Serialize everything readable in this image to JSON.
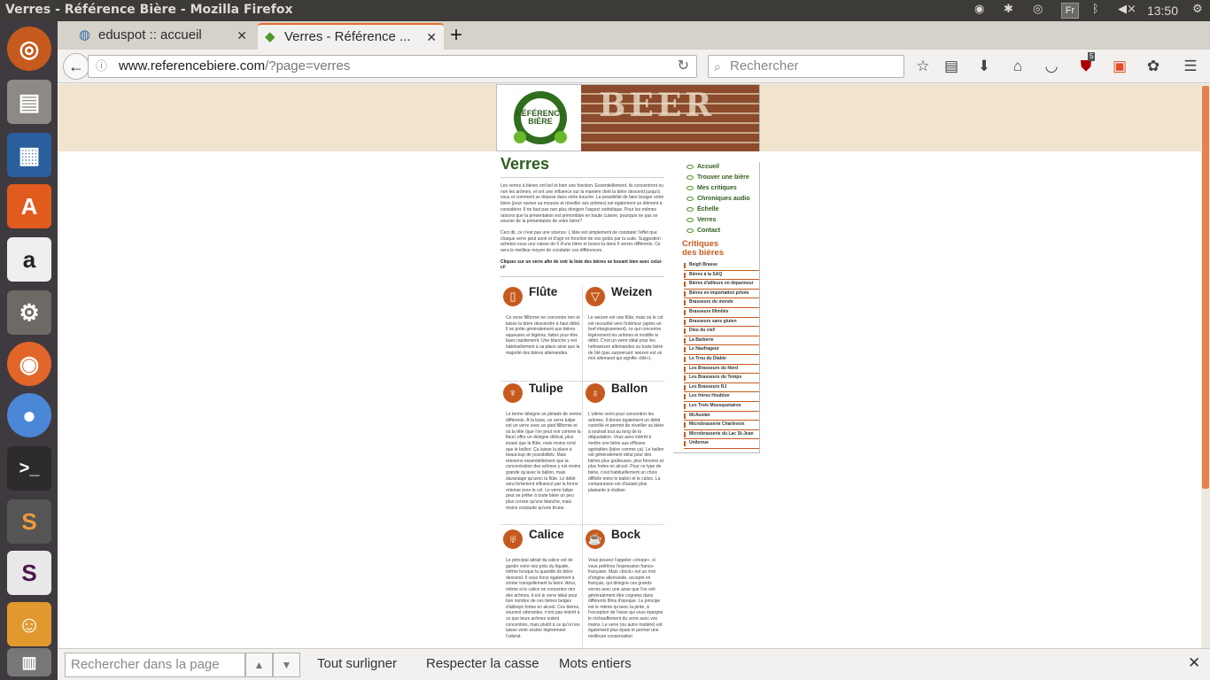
{
  "topbar": {
    "window_title": "Verres - Référence Bière - Mozilla Firefox",
    "keyboard_layout": "Fr",
    "clock": "13:50"
  },
  "tabs": [
    {
      "label": "eduspot :: accueil",
      "active": false
    },
    {
      "label": "Verres - Référence ...",
      "active": true
    }
  ],
  "navbar": {
    "url_host": "www.referencebiere.com",
    "url_path": "/?page=verres",
    "search_placeholder": "Rechercher",
    "ublock_badge": "5"
  },
  "site": {
    "logo_lines": [
      "RÉFÉRENCE",
      "BIÈRE"
    ],
    "banner_word": "BEER",
    "page_title": "Verres",
    "intro_paragraphs": [
      "Les verres à bières ont bel et bien une fonction. Essentiellement, ils concentrent ou non les arômes, et ont une influence sur la manière dont la bière descend jusqu'à vous et comment se dépose dans votre bouche. La possibilité de faire bouger votre bière (pour raviver sa mousse et réveiller ses arômes) est également un élément à considérer. Il ne faut pas non plus dénigrer l'aspect esthétique. Pour les mêmes raisons que la présentation est primordiale en haute cuisine, pourquoi ne pas se soucier de la présentation de votre bière?",
      "Ceci dit, ce n'est pas une science. L'idée est simplement de constater l'effet que chaque verre peut avoir et d'agir en fonction de vos goûts par la suite. Suggestion : achetez-vous une caisse de 6 d'une bière et buvez-la dans 6 verres différents. Ce sera le meilleur moyen de constater ces différences."
    ],
    "click_hint": "Cliquez sur un verre afin de voir la liste des bières se buvant bien avec celui-ci!",
    "glasses": [
      {
        "name": "Flûte",
        "icon": "flute-glass-icon",
        "desc": "Ce verre fillforme ne concentre rien et laisse la bière descendre à haut débit. Il se prête généralement aux bières aqueuses et légères, faites pour être bues rapidement. Une blanche y est habituellement à sa place ainsi que la majorité des bières allemandes."
      },
      {
        "name": "Weizen",
        "icon": "weizen-glass-icon",
        "desc": "Le weizen est une flûte, mais où le col est recourbé vers l'intérieur (après un bref élargissement), ce qui concentre légèrement les arômes et modifie le débit. C'est un verre idéal pour les hefeweizen allemandes ou toute bière de blé (pas surprenant: weizen est un mot allemand qui signifie «blé»)."
      },
      {
        "name": "Tulipe",
        "icon": "tulipe-glass-icon",
        "desc": "Le terme désigne un pléiade de verres différents. À la base, un verre tulipe est un verre avec un pied fillforme et où la tête (que l'on peut voir comme la fleur) offre un désigne délicat, plus évasé que la flûte, mais moins rond que le ballon. Ça laisse la place à beaucoup de possibilités. Mais retenons essentiellement que la concentration des arômes y est moins grande qu'avec le ballon, mais davantage qu'avec la flûte. Le débit sera fortement influencé par la forme retenue pour le col. Le verre tulipe peut se prêter à toute bière un peu plus corsée qu'une blanche, mais moins costaude qu'une brune."
      },
      {
        "name": "Ballon",
        "icon": "ballon-glass-icon",
        "desc": "L'ultime verre pour concentrer les arômes. Il donne également un débit contrôlé et permet de réveiller sa bière à souhait tout au long de la dégustation. Vous avez intérêt à mettre une bière aux effluves agréables (bière comme ça). Le ballon est généralement idéal pour des bières plus goûteuses, plus foncées et plus fortes en alcool. Pour ce type de bière, c'est habituellement un choix difficile entre le ballon et le calice. La comparaison est d'autant plus plaisante à réaliser."
      },
      {
        "name": "Calice",
        "icon": "calice-glass-icon",
        "desc": "Le principal attrait du calice est de garder votre nez près du liquide, même lorsque la quantité de bière descend. Il vous force également à siroter tranquillement la bière. Ainsi, même si le calice ne concentre rien des arômes, il est le verre idéal pour bon nombre de ces bières belges d'abbaye fortes en alcool. Ces bières, souvent odorantes, n'ont pas intérêt à ce que leurs arômes soient concentrés, mais plutôt à ce qu'on les laisse venir exciter légèrement l'odorat."
      },
      {
        "name": "Bock",
        "icon": "bock-mug-icon",
        "desc": "Vous pouvez l'appeler «chope», si vous préférez l'expression franco-française. Mais «bock» est un mot d'origine allemande, accepté en français, qui désigne ces grands verres avec une anse que l'on voit généralement être cognées dans différents films d'époque. Le principe est le même qu'avec la pinte, à l'exception de l'anse qui vous épargne le réchauffement du verre avec vos mains. Le verre (ou autre matière) est également plus épais et permet une meilleure conservation"
      }
    ],
    "nav": [
      "Accueil",
      "Trouver une bière",
      "Mes critiques",
      "Chroniques audio",
      "Échelle",
      "Verres",
      "Contact"
    ],
    "critiques_title": "Critiques des bières",
    "critiques": [
      "Beigh Brasse",
      "Bières à la SAQ",
      "Bières d'ailleurs en dépanneur",
      "Bières en importation privée",
      "Brasseurs du monde",
      "Brasseurs Illimités",
      "Brasseurs sans gluten",
      "Dieu du ciel!",
      "La Barberie",
      "Le Naufrageur",
      "Le Trou du Diable",
      "Les Brasseurs du Nord",
      "Les Brasseurs du Temps",
      "Les Brasseurs RJ",
      "Les frères Houblon",
      "Les Trois Mousquetaires",
      "McAuslan",
      "Microbrasserie Charlevoix",
      "Microbrasserie du Lac St-Jean",
      "Unibroue"
    ],
    "accent_color": "#c65a1e",
    "green_color": "#2f5d1e"
  },
  "findbar": {
    "placeholder": "Rechercher dans la page",
    "highlight_all": "Tout surligner",
    "match_case": "Respecter la casse",
    "whole_words": "Mots entiers"
  }
}
